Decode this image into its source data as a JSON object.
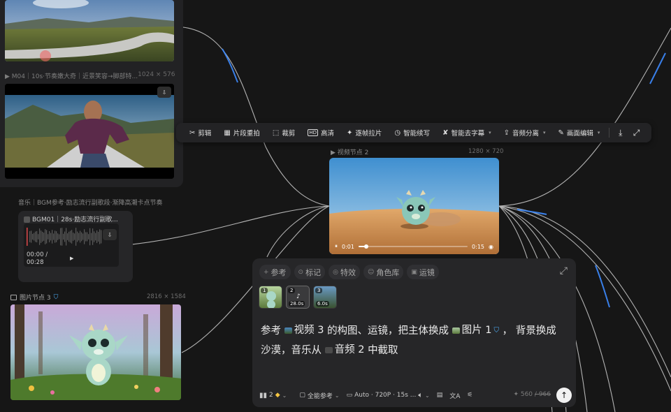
{
  "left_panel": {
    "top_caption": "▶ M04｜10s·节奏嫩大奇｜近景笑容→脚部特...",
    "top_caption_dims": "1024 × 576"
  },
  "toolbar": {
    "items": [
      {
        "icon": "✂",
        "label": "剪辑"
      },
      {
        "icon": "▦",
        "label": "片段重拍"
      },
      {
        "icon": "⬚",
        "label": "裁剪"
      },
      {
        "icon": "HD",
        "label": "高清"
      },
      {
        "icon": "✦",
        "label": "逐帧拉片"
      },
      {
        "icon": "◷",
        "label": "智能续写"
      },
      {
        "icon": "✘",
        "label": "智能去字幕"
      },
      {
        "icon": "⇪",
        "label": "音频分离"
      },
      {
        "icon": "✎",
        "label": "画面编辑"
      }
    ]
  },
  "video_node": {
    "title": "▶ 视频节点 2",
    "dims": "1280 × 720",
    "time_current": "0:01",
    "time_total": "0:15",
    "progress": 0.07
  },
  "audio_node": {
    "label": "音乐｜BGM参考·励志流行副歌段·渐降高潮卡点节奏",
    "card_title": "BGM01｜28s·励志流行副歌...",
    "time_current": "00:00 /",
    "time_total": "00:28"
  },
  "image_node": {
    "title": "图片节点 3",
    "dims": "2816 × 1584"
  },
  "prompt_panel": {
    "chips": [
      {
        "icon": "+",
        "label": "参考"
      },
      {
        "icon": "⊙",
        "label": "标记"
      },
      {
        "icon": "◎",
        "label": "特效"
      },
      {
        "icon": "☺",
        "label": "角色库"
      },
      {
        "icon": "▣",
        "label": "运镜"
      }
    ],
    "refs": [
      {
        "num": "1",
        "duration": ""
      },
      {
        "num": "2",
        "duration": "28.0s"
      },
      {
        "num": "3",
        "duration": "6.0s"
      }
    ],
    "text": {
      "p1": "参考",
      "tok1": "视频 3",
      "p2": "的构图、运镜，把主体换成",
      "tok2": "图片 1",
      "p3": "， 背景换成",
      "p4": "沙漠，音乐从",
      "tok3": "音频 2",
      "p5": "中截取"
    },
    "bottom": {
      "model": "2",
      "ref_mode": "全能参考",
      "settings": "Auto · 720P · 15s ...",
      "credits_used": "✦ 560",
      "credits_max": "/ 966"
    }
  }
}
